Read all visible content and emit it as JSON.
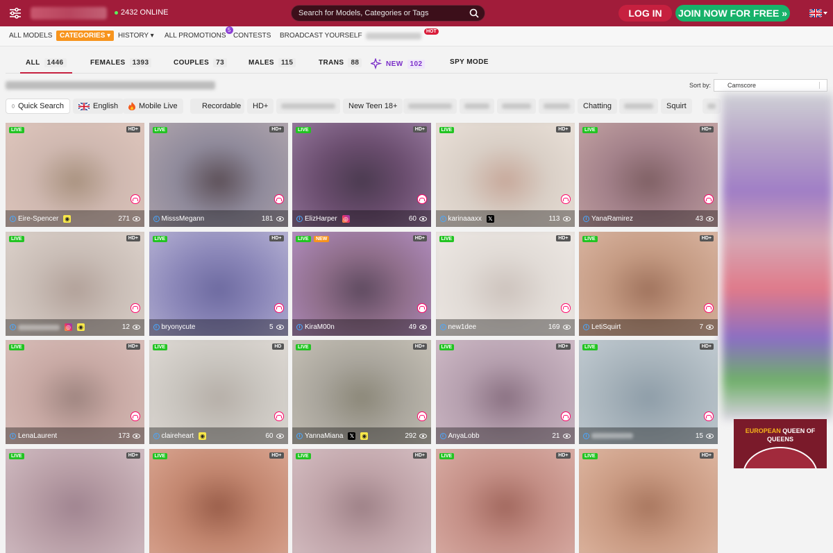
{
  "header": {
    "online_count": "2432 ONLINE",
    "search_placeholder": "Search for Models, Categories or Tags",
    "login_label": "LOG IN",
    "join_label": "JOIN NOW FOR FREE »"
  },
  "subnav": {
    "all_models": "ALL MODELS",
    "categories": "CATEGORIES ▾",
    "history": "HISTORY ▾",
    "all_promotions": "ALL PROMOTIONS",
    "promotions_badge": "5",
    "contests": "CONTESTS",
    "broadcast": "BROADCAST YOURSELF",
    "hot_badge": "HOT"
  },
  "tabs": [
    {
      "label": "ALL",
      "count": "1446"
    },
    {
      "label": "FEMALES",
      "count": "1393"
    },
    {
      "label": "COUPLES",
      "count": "73"
    },
    {
      "label": "MALES",
      "count": "115"
    },
    {
      "label": "TRANS",
      "count": "88"
    },
    {
      "label": "NEW",
      "count": "102"
    },
    {
      "label": "SPY MODE",
      "count": ""
    }
  ],
  "sort": {
    "label": "Sort by:",
    "value": "Camscore"
  },
  "chips": {
    "quick_search": "Quick Search",
    "english": "English",
    "mobile_live": "Mobile Live",
    "recordable": "Recordable",
    "hd": "HD+",
    "new_teen": "New Teen 18+",
    "chatting": "Chatting",
    "squirt": "Squirt"
  },
  "promo": {
    "line1_gold": "EUROPEAN",
    "line1_rest": " QUEEN OF",
    "line2": "QUEENS"
  },
  "cards": [
    {
      "name": "Eire-Spencer",
      "viewers": "271",
      "hd": "HD+",
      "social": [
        "snap"
      ],
      "newbadge": ""
    },
    {
      "name": "MisssMegann",
      "viewers": "181",
      "hd": "HD+",
      "social": [],
      "newbadge": ""
    },
    {
      "name": "ElizHarper",
      "viewers": "60",
      "hd": "HD+",
      "social": [
        "insta"
      ],
      "newbadge": ""
    },
    {
      "name": "karinaaaxx",
      "viewers": "113",
      "hd": "HD+",
      "social": [
        "x"
      ],
      "newbadge": ""
    },
    {
      "name": "YanaRamirez",
      "viewers": "43",
      "hd": "HD+",
      "social": [],
      "newbadge": ""
    },
    {
      "name": "",
      "viewers": "12",
      "hd": "HD+",
      "social": [
        "insta",
        "snap"
      ],
      "newbadge": ""
    },
    {
      "name": "bryonycute",
      "viewers": "5",
      "hd": "HD+",
      "social": [],
      "newbadge": ""
    },
    {
      "name": "KiraM00n",
      "viewers": "49",
      "hd": "HD+",
      "social": [],
      "newbadge": "NEW"
    },
    {
      "name": "new1dee",
      "viewers": "169",
      "hd": "HD+",
      "social": [],
      "newbadge": ""
    },
    {
      "name": "LetiSquirt",
      "viewers": "7",
      "hd": "HD+",
      "social": [],
      "newbadge": ""
    },
    {
      "name": "LenaLaurent",
      "viewers": "173",
      "hd": "HD+",
      "social": [],
      "newbadge": ""
    },
    {
      "name": "claireheart",
      "viewers": "60",
      "hd": "HD",
      "social": [
        "snap"
      ],
      "newbadge": ""
    },
    {
      "name": "YannaMiana",
      "viewers": "292",
      "hd": "HD+",
      "social": [
        "x",
        "snap"
      ],
      "newbadge": ""
    },
    {
      "name": "AnyaLobb",
      "viewers": "21",
      "hd": "HD+",
      "social": [],
      "newbadge": ""
    },
    {
      "name": "",
      "viewers": "15",
      "hd": "HD+",
      "social": [],
      "newbadge": ""
    },
    {
      "name": "",
      "viewers": "",
      "hd": "HD+",
      "social": [],
      "newbadge": ""
    },
    {
      "name": "",
      "viewers": "",
      "hd": "HD+",
      "social": [],
      "newbadge": ""
    },
    {
      "name": "",
      "viewers": "",
      "hd": "HD+",
      "social": [],
      "newbadge": ""
    },
    {
      "name": "",
      "viewers": "",
      "hd": "HD+",
      "social": [],
      "newbadge": ""
    },
    {
      "name": "",
      "viewers": "",
      "hd": "HD+",
      "social": [],
      "newbadge": ""
    }
  ],
  "live_label": "LIVE",
  "colors": {
    "brand": "#a11c3a",
    "join": "#17b26a",
    "category_tab": "#f7941d",
    "live": "#22c422",
    "new_tab": "#7a2ec8"
  }
}
